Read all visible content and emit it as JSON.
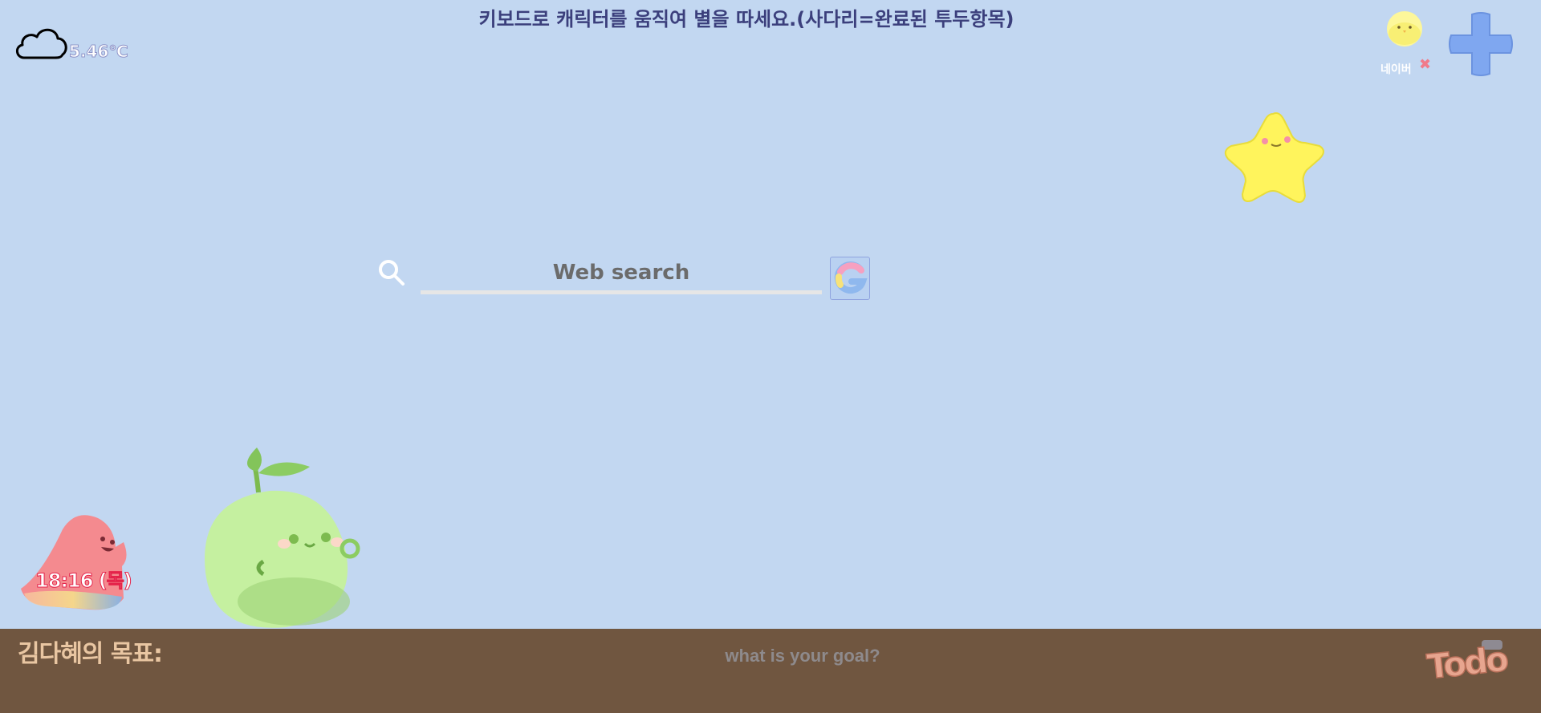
{
  "weather": {
    "temperature": "5.46℃",
    "icon": "cloud-icon"
  },
  "header": {
    "instruction": "키보드로 캐릭터를 움직여 별을 따세요.(사다리=완료된 투두항목)"
  },
  "shortcuts": {
    "naver": {
      "label": "네이버",
      "remove_icon": "close-icon"
    },
    "add": {
      "icon": "plus-icon"
    }
  },
  "search": {
    "placeholder": "Web search",
    "icon": "search-icon",
    "engine_button_icon": "google-icon"
  },
  "clock": {
    "time": "18:16 (목)"
  },
  "footer": {
    "goal_title": "김다혜의 목표:",
    "goal_placeholder": "what is your goal?",
    "todo_label": "Todo"
  },
  "colors": {
    "background": "#c2d7f1",
    "footer": "#705640",
    "header_text": "#3b3f7c",
    "goal_title": "#e9c6a2"
  }
}
